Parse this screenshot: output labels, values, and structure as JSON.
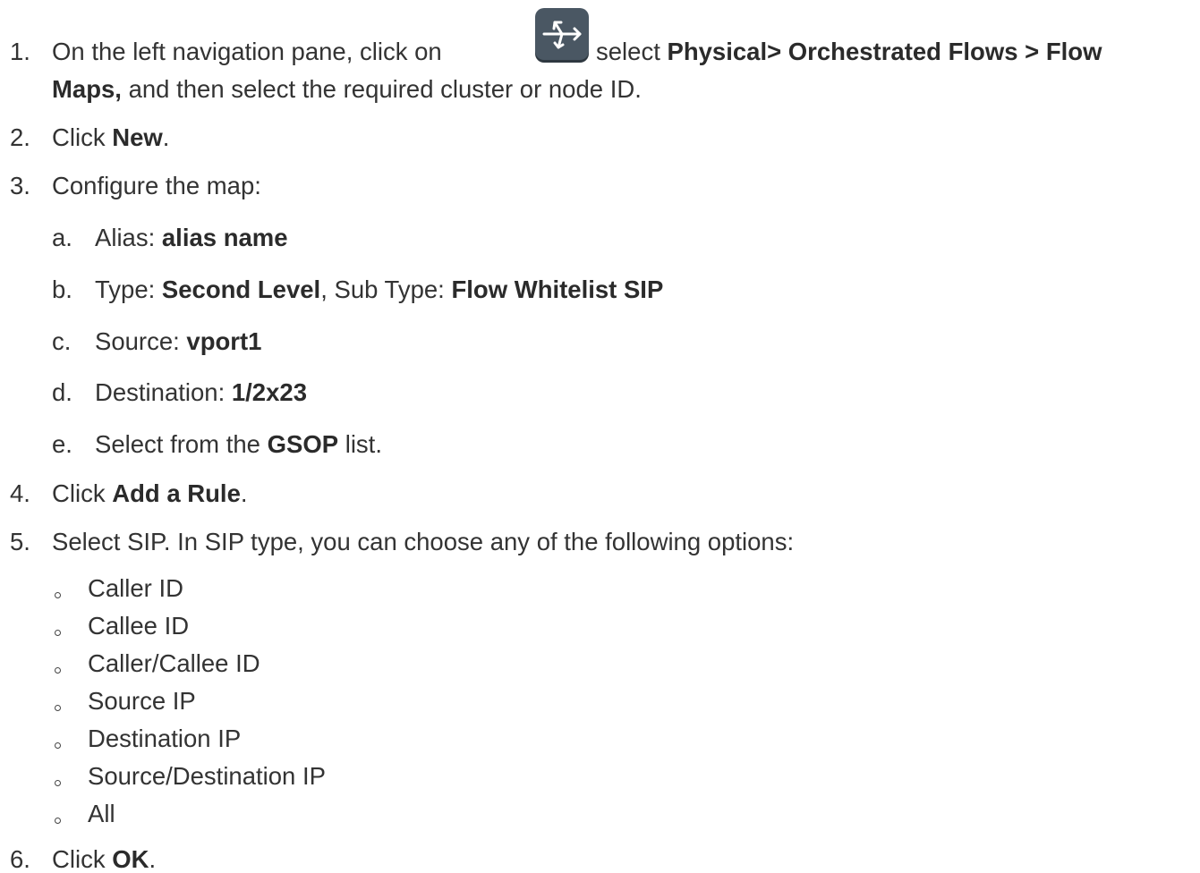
{
  "steps": [
    {
      "num": "1.",
      "text_a": "On the left navigation pane, click on",
      "text_b": "select",
      "bold_path": "Physical> Orchestrated Flows > Flow",
      "bold_maps": "Maps,",
      "text_c": "and then select the required cluster or node ID."
    },
    {
      "num": "2.",
      "pre": "Click",
      "bold": "New",
      "post": "."
    },
    {
      "num": "3.",
      "text": "Configure the map:"
    },
    {
      "num": "4.",
      "pre": "Click",
      "bold": "Add a Rule",
      "post": "."
    },
    {
      "num": "5.",
      "text": "Select SIP. In SIP type, you can choose any of the following options:"
    },
    {
      "num": "6.",
      "pre": "Click",
      "bold": "OK",
      "post": "."
    }
  ],
  "substeps": [
    {
      "letter": "a.",
      "pre": "Alias:",
      "bold": "alias name"
    },
    {
      "letter": "b.",
      "pre": "Type:",
      "bold": "Second Level",
      "mid": ", Sub Type:",
      "bold2": "Flow Whitelist SIP"
    },
    {
      "letter": "c.",
      "pre": "Source:",
      "bold": "vport1"
    },
    {
      "letter": "d.",
      "pre": "Destination:",
      "bold": "1/2x23"
    },
    {
      "letter": "e.",
      "pre": "Select from the",
      "bold": "GSOP",
      "post": "list."
    }
  ],
  "sip_options": [
    "Caller ID",
    "Callee ID",
    "Caller/Callee ID",
    "Source IP",
    "Destination IP",
    "Source/Destination IP",
    "All"
  ],
  "icons": {
    "flow_button": "orchestrated-flows-icon",
    "flow_button_color": "#4a5763"
  }
}
